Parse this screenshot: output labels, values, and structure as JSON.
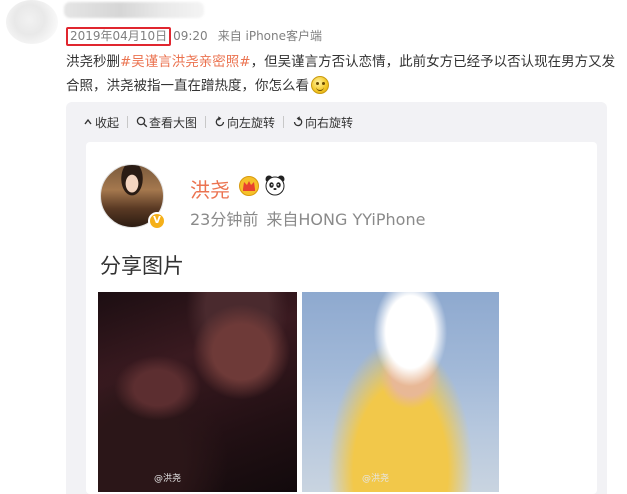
{
  "post": {
    "date": "2019年04月10日",
    "time": "09:20",
    "source": "来自 iPhone客户端",
    "text_before": "洪尧秒删",
    "hashtag": "#吴谨言洪尧亲密照#",
    "text_after": "，但吴谨言方否认恋情，此前女方已经予以否认现在男方又发合照，洪尧被指一直在蹭热度，你怎么看",
    "emoji": "smile-emoji"
  },
  "toolbar": {
    "collapse": "收起",
    "view_large": "查看大图",
    "rotate_left": "向左旋转",
    "rotate_right": "向右旋转"
  },
  "inner_post": {
    "name": "洪尧",
    "time": "23分钟前",
    "source": "来自HONG YYiPhone",
    "title": "分享图片",
    "badges": [
      "crown-icon",
      "panda-icon"
    ],
    "verified_icon": "verified-badge-icon",
    "watermark1": "@洪尧",
    "watermark2": "@洪尧"
  },
  "colors": {
    "hashtag": "#eb7350",
    "highlight_box": "#e0262f",
    "name": "#eb7350"
  }
}
